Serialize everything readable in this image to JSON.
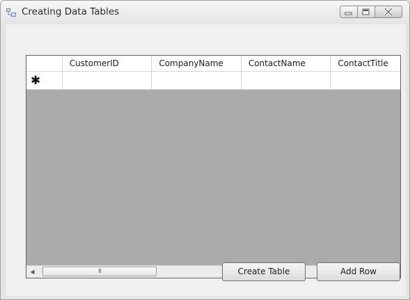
{
  "window": {
    "title": "Creating Data Tables",
    "icon": "form-icon",
    "controls": [
      "minimize-icon",
      "maximize-icon",
      "close-icon"
    ]
  },
  "grid": {
    "columns": [
      "CustomerID",
      "CompanyName",
      "ContactName",
      "ContactTitle"
    ],
    "new_row_indicator": "✱",
    "new_row_cells": [
      "",
      "",
      "",
      ""
    ],
    "hscroll": {
      "thumb_grip": "III",
      "left_arrow": "◀",
      "right_arrow": "▶"
    }
  },
  "buttons": {
    "create_table": "Create Table",
    "add_row": "Add Row"
  }
}
